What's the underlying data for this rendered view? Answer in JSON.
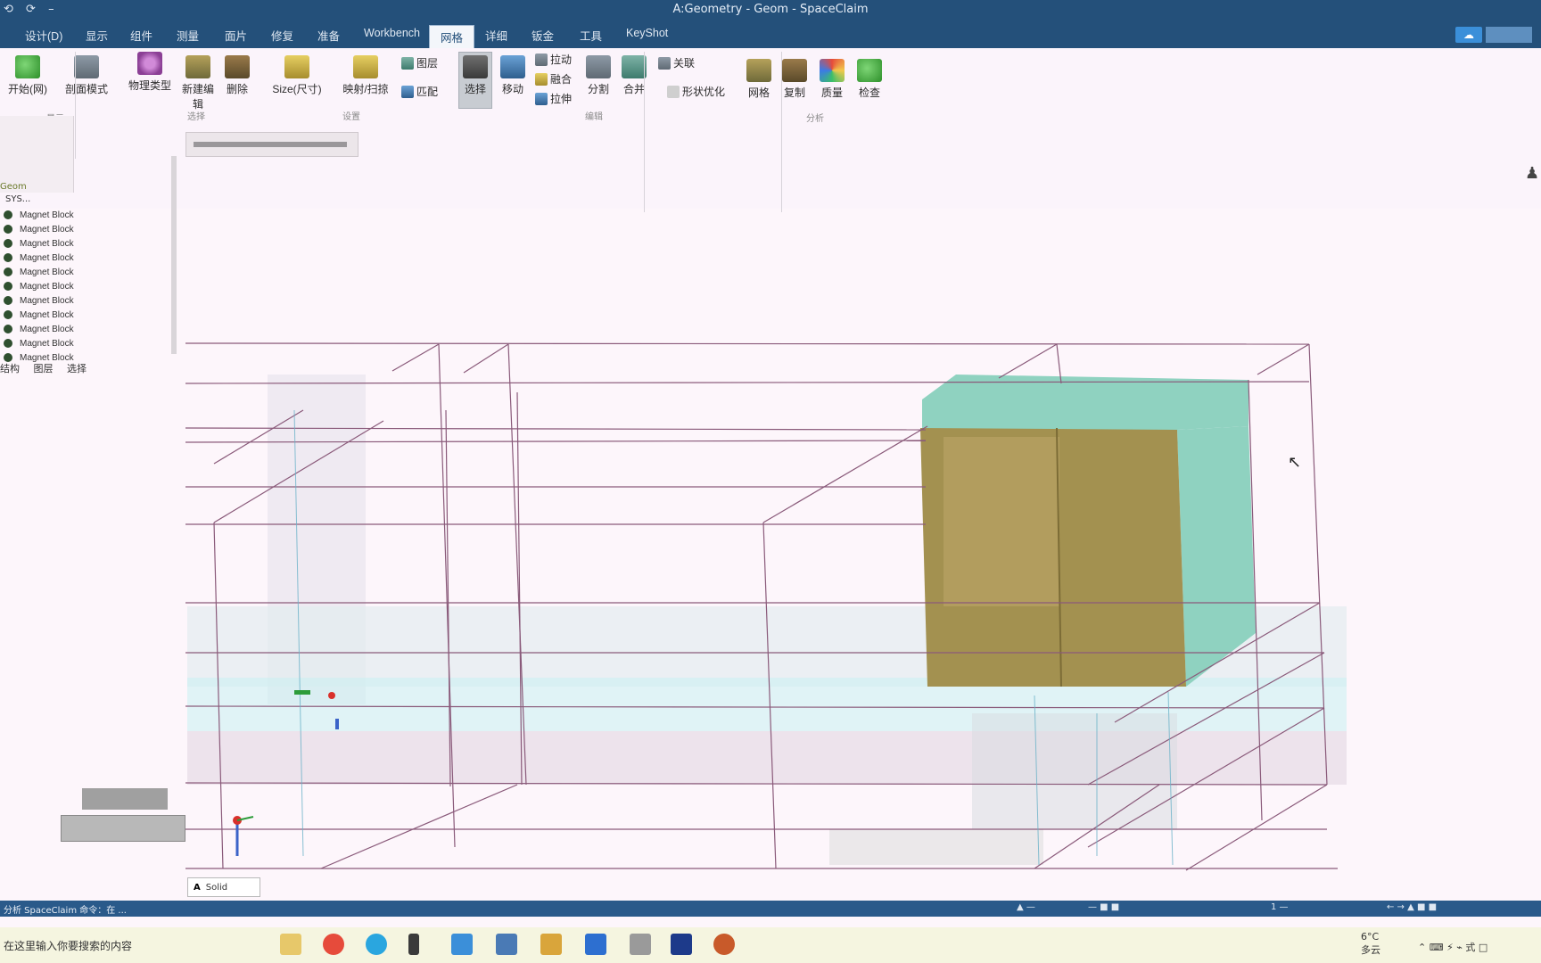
{
  "window": {
    "title": "A:Geometry - Geom - SpaceClaim",
    "quick_access": [
      "⟲",
      "⟳",
      "–"
    ]
  },
  "ribbon_tabs": [
    "设计(D)",
    "显示",
    "组件",
    "测量",
    "面片",
    "修复",
    "准备",
    "Workbench",
    "网格",
    "详细",
    "钣金",
    "工具",
    "KeyShot"
  ],
  "active_tab": "网格",
  "ribbon": {
    "buttons": {
      "start": "开始(网)",
      "profile": "剖面模式",
      "physics": "物理类型",
      "new_edit": "新建编辑",
      "delete": "删除",
      "size": "Size(尺寸)",
      "map": "映射/扫掠",
      "layer": "图层",
      "match": "匹配",
      "select": "选择",
      "move": "移动",
      "pull": "拉动",
      "merge": "融合",
      "extend": "拉伸",
      "split": "分割",
      "combine": "合并",
      "relate": "关联",
      "shape_opt": "形状优化",
      "mesh": "网格",
      "copy": "复制",
      "quality": "质量",
      "check": "检查"
    },
    "group_labels": [
      "显示",
      "设置",
      "选择",
      "编辑",
      "分析"
    ]
  },
  "structure_tree": {
    "root": "Geom",
    "sub": "SYS...",
    "items": [
      "Magnet Block",
      "Magnet Block",
      "Magnet Block",
      "Magnet Block",
      "Magnet Block",
      "Magnet Block",
      "Magnet Block",
      "Magnet Block",
      "Magnet Block",
      "Magnet Block",
      "Magnet Block"
    ],
    "panel_tabs": [
      "结构",
      "图层",
      "选择"
    ]
  },
  "viewport": {
    "mini_toolbar_label": "Solid",
    "mini_toolbar_icon": "A"
  },
  "status": {
    "left": "分析 SpaceClaim 命令：在 ...",
    "r1": "▲ —",
    "r2": "— ■ ■",
    "r3": "1 —",
    "r4": "← → ▲ ■ ■"
  },
  "taskbar": {
    "search": "在这里输入你要搜索的内容",
    "temp": "6°C",
    "weather": "多云",
    "time_icons": "⌃ ⌨ ⚡ ⌁ 式 □"
  },
  "colors": {
    "title_bar": "#24507a",
    "ribbon_bg": "#fbf4fb",
    "viewport_bg": "#fdf6fb",
    "magnet_front": "#a39150",
    "magnet_side": "#8fd2c0"
  }
}
